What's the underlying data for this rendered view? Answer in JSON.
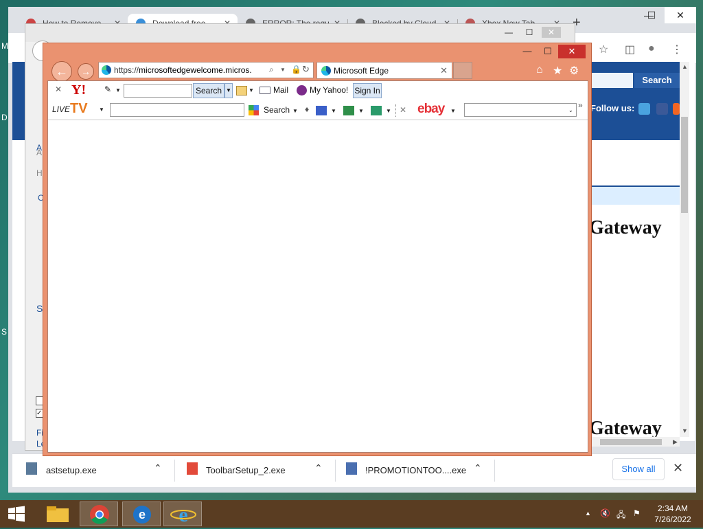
{
  "desktop": {
    "left_letters": [
      "M",
      "D",
      "S"
    ]
  },
  "chrome": {
    "tabs": [
      {
        "label": "How to Remove",
        "active": false
      },
      {
        "label": "Download free",
        "active": true
      },
      {
        "label": "ERROR: The requ",
        "active": false
      },
      {
        "label": "Blocked by Cloud",
        "active": false
      },
      {
        "label": "Xbox New Tab",
        "active": false
      }
    ],
    "new_tab": "+",
    "window_controls": {
      "minimize": "—",
      "maximize": "☐",
      "close": "✕"
    },
    "toolbar_icons": {
      "star": "☆",
      "panel": "◫",
      "profile": "●",
      "menu": "⋮"
    },
    "page": {
      "search_label": "Search",
      "follow_us": "Follow us:",
      "heading_top": "Gateway",
      "heading_bottom": "Gateway",
      "left_frags": [
        "A",
        "Ho",
        "A",
        "O",
        "Se",
        "Fi",
        "Le"
      ]
    },
    "downloads": [
      {
        "file": "astsetup.exe"
      },
      {
        "file": "ToolbarSetup_2.exe"
      },
      {
        "file": "!PROMOTIONTOO....exe"
      }
    ],
    "show_all": "Show all",
    "shelf_close": "✕"
  },
  "mid_window": {
    "controls": {
      "minimize": "—",
      "maximize": "☐",
      "close": "✕"
    }
  },
  "ie": {
    "controls": {
      "minimize": "—",
      "maximize": "☐",
      "close": "✕"
    },
    "address": {
      "url_prefix": "https://",
      "url_host": "microsoftedgewelcome.micros..."
    },
    "tab_title": "Microsoft Edge",
    "tab_close": "✕",
    "right_icons": {
      "home": "⌂",
      "favorites": "★",
      "tools": "⚙"
    },
    "yahoo_toolbar": {
      "close": "✕",
      "logo": "Y!",
      "search_button": "Search",
      "mail": "Mail",
      "my_yahoo": "My Yahoo!",
      "sign_in": "Sign In"
    },
    "livetv_toolbar": {
      "logo_live": "LIVE",
      "logo_tv": "TV",
      "search_label": "Search",
      "ebay": "ebay",
      "close": "✕",
      "more": "»"
    }
  },
  "taskbar": {
    "time": "2:34 AM",
    "date": "7/26/2022",
    "tray_arrow": "▲"
  }
}
